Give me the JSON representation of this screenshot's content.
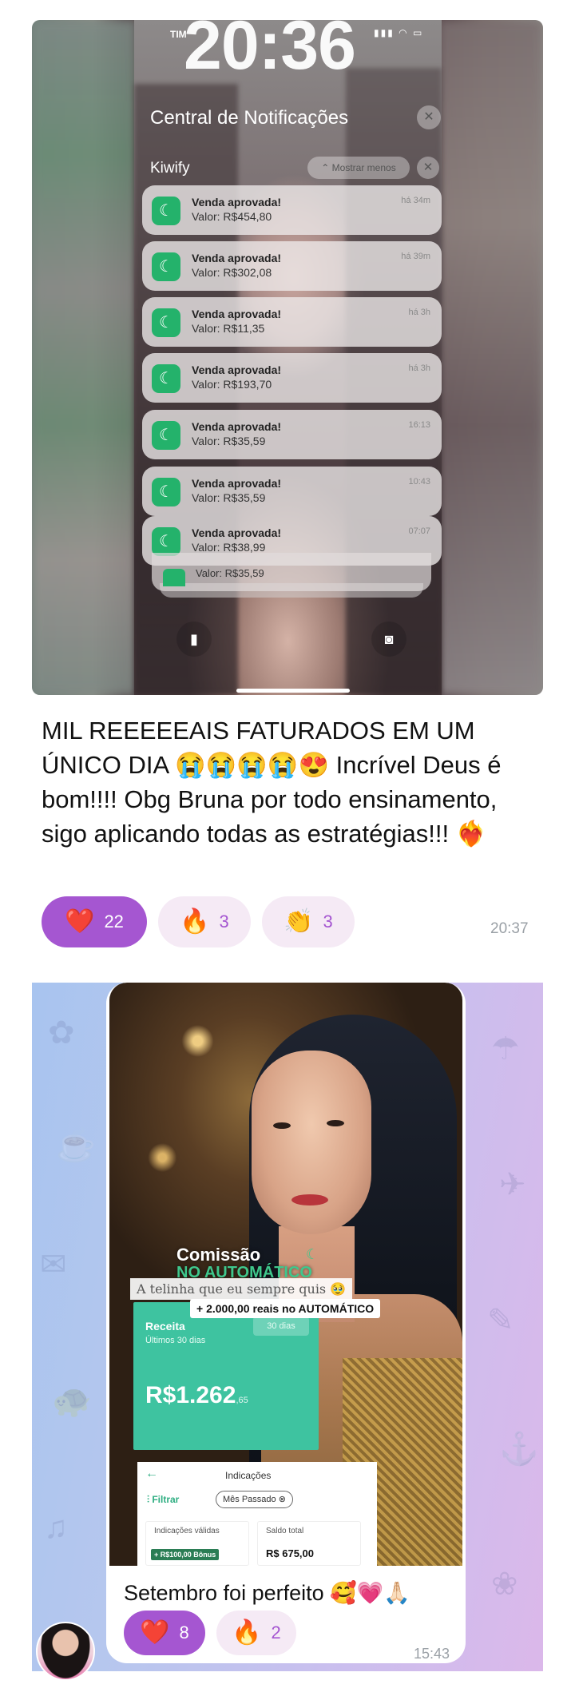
{
  "post1": {
    "screenshot": {
      "carrier": "TIM",
      "clock": "20:36",
      "notification_center_title": "Central de Notificações",
      "close_glyph": "✕",
      "group_app": "Kiwify",
      "show_less_label": "⌃ Mostrar menos",
      "notifications": [
        {
          "title": "Venda aprovada!",
          "body": "Valor: R$454,80",
          "time": "há 34m"
        },
        {
          "title": "Venda aprovada!",
          "body": "Valor: R$302,08",
          "time": "há 39m"
        },
        {
          "title": "Venda aprovada!",
          "body": "Valor: R$11,35",
          "time": "há 3h"
        },
        {
          "title": "Venda aprovada!",
          "body": "Valor: R$193,70",
          "time": "há 3h"
        },
        {
          "title": "Venda aprovada!",
          "body": "Valor: R$35,59",
          "time": "16:13"
        },
        {
          "title": "Venda aprovada!",
          "body": "Valor: R$35,59",
          "time": "10:43"
        },
        {
          "title": "Venda aprovada!",
          "body": "Valor: R$38,99",
          "time": "07:07"
        }
      ],
      "stacked_body": "Valor: R$35,59",
      "app_icon": "kiwify-icon",
      "flashlight_icon": "flashlight-icon",
      "camera_icon": "camera-icon"
    },
    "caption": "MIL REEEEEAIS FATURADOS EM UM ÚNICO DIA 😭😭😭😭😍 Incrível Deus é bom!!!! Obg Bruna por todo ensinamento, sigo aplicando todas as estratégias!!! ❤️‍🔥",
    "reactions": [
      {
        "emoji": "❤️",
        "count": "22",
        "mine": true
      },
      {
        "emoji": "🔥",
        "count": "3",
        "mine": false
      },
      {
        "emoji": "👏",
        "count": "3",
        "mine": false
      }
    ],
    "time": "20:37"
  },
  "post2": {
    "image": {
      "comissao_line1": "Comissão",
      "comissao_line2": "NO AUTOMÁTICO",
      "tagline": "A telinha que eu sempre quis 🥹",
      "subtag": "+ 2.000,00 reais no AUTOMÁTICO",
      "revenue_title": "Receita",
      "revenue_period": "Últimos 30 dias",
      "revenue_pill": "30 dias",
      "revenue_value": "R$1.262",
      "revenue_cents": ",65",
      "panel_title": "Indicações",
      "filter_label": "Filtrar",
      "month_chip": "Mês Passado ⊗",
      "valid_label": "Indicações válidas",
      "bonus_label": "+ R$100,00 Bônus",
      "balance_label": "Saldo total",
      "balance_value": "R$ 675,00"
    },
    "caption": "Setembro foi perfeito 🥰💗🙏🏻",
    "reactions": [
      {
        "emoji": "❤️",
        "count": "8",
        "mine": true
      },
      {
        "emoji": "🔥",
        "count": "2",
        "mine": false
      }
    ],
    "time": "15:43"
  },
  "colors": {
    "reaction_mine": "#a556d1",
    "reaction_other_bg": "#f5eaf5",
    "kiwify_green": "#24b26b",
    "revenue_card": "#3ec3a0"
  }
}
